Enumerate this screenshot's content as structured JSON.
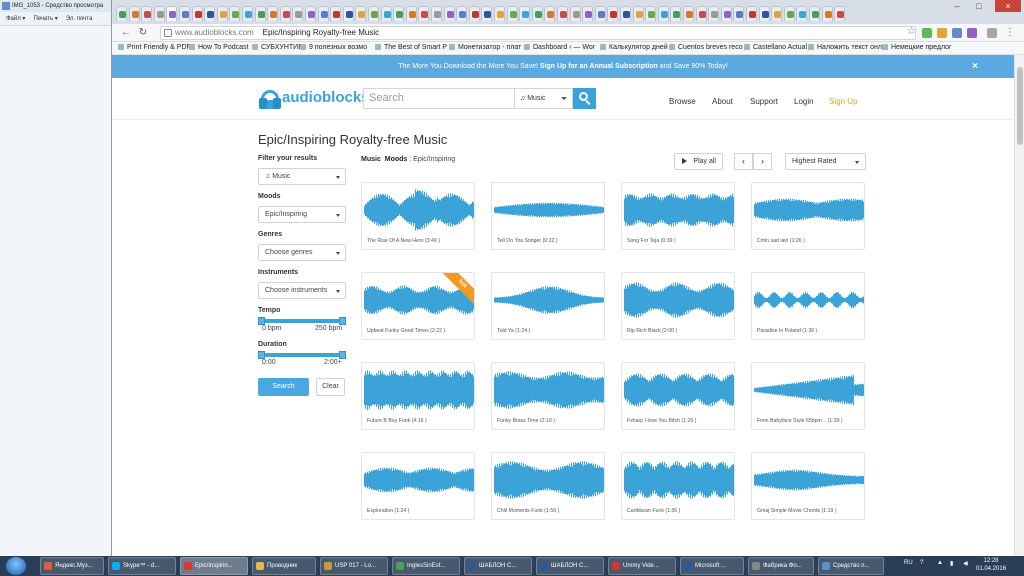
{
  "background_window": {
    "title": "IMG_1053 - Средство просмотра",
    "menu": [
      "Файл ▾",
      "Печать ▾",
      "Эл. почта"
    ]
  },
  "browser": {
    "url_host": "www.audioblocks.com",
    "url_path": "Epic/Inspiring Royalty-free Music",
    "bookmarks": [
      "Print Friendly & PDF",
      "How To Podcast",
      "СУБХУНТИВ",
      "9 полезных возмо",
      "The Best of Smart P",
      "Монетизатор - плат",
      "Dashboard ‹ — Wor",
      "Калькулятор дней",
      "Cuentos breves reco",
      "Castellano Actual",
      "Наложить текст онл",
      "Немецкие предлог"
    ]
  },
  "promo": {
    "text": "The More You Download the More You Save!",
    "link": "Sign Up for an Annual Subscription",
    "tail": "and Save 90% Today!",
    "close": "×"
  },
  "header": {
    "logo": "audioblocks",
    "search_placeholder": "Search",
    "search_category": "Music",
    "nav": [
      "Browse",
      "About",
      "Support",
      "Login",
      "Sign Up"
    ]
  },
  "page_title": "Epic/Inspiring Royalty-free Music",
  "filters": {
    "title": "Filter your results",
    "media": "Music",
    "moods_label": "Moods",
    "moods_value": "Epic/Inspiring",
    "genres_label": "Genres",
    "genres_value": "Choose genres",
    "instruments_label": "Instruments",
    "instruments_value": "Choose instruments",
    "tempo_label": "Tempo",
    "tempo_min": "0 bpm",
    "tempo_max": "250 bpm",
    "duration_label": "Duration",
    "duration_min": "0:00",
    "duration_max": "2:00+",
    "search_btn": "Search",
    "clear_btn": "Clear"
  },
  "results": {
    "crumb_music": "Music",
    "crumb_moods": "Moods",
    "crumb_sep": ":",
    "crumb_value": "Epic/Inspiring",
    "play_all": "Play all",
    "prev": "‹",
    "next": "›",
    "sort": "Highest Rated",
    "hot_label": "hot",
    "tracks": [
      {
        "title": "The Rise Of A New Hero  (3:49 )"
      },
      {
        "title": "Tell On You Stinger (0:22 )"
      },
      {
        "title": "Song For Teja (0:39 )"
      },
      {
        "title": "Cmin sad iain (1:26 )"
      },
      {
        "title": "Upbeat Funky Good Times (2:22 )",
        "hot": true
      },
      {
        "title": "Told Ya (1:24 )"
      },
      {
        "title": "Rip Rich Black (2:00 )"
      },
      {
        "title": "Paradise In Poland (1:36 )"
      },
      {
        "title": "Future B Boy Funk (4:16 )"
      },
      {
        "title": "Funky Brass Time (2:10 )"
      },
      {
        "title": "Fsharp I love You Bitch (1:26 )"
      },
      {
        "title": "Fmin Babyface Style 65bpm... (1:39 )"
      },
      {
        "title": "Exploration (1:24 )"
      },
      {
        "title": "Chill Moments Funk (1:56 )"
      },
      {
        "title": "Caribbean Funk (1:36 )"
      },
      {
        "title": "Gmaj Simple Movie Chords (1:19 )"
      }
    ]
  },
  "taskbar": {
    "items": [
      "Яндекс.Муз...",
      "Skype™ - d...",
      "Epic/Inspirin...",
      "Проводник",
      "USP 017 - Lo...",
      "InglesSinEsf...",
      "ШАБЛОН С...",
      "ШАБЛОН С...",
      "Ummy Vide...",
      "Microsoft ...",
      "Фабрика Фо...",
      "Средство п..."
    ],
    "lang": "RU",
    "time": "12:28",
    "date": "01.04.2016"
  },
  "colors": {
    "accent": "#3ba3d8",
    "promo": "#5aa9e0",
    "signup": "#e9a21b",
    "hot": "#f29a1f"
  }
}
